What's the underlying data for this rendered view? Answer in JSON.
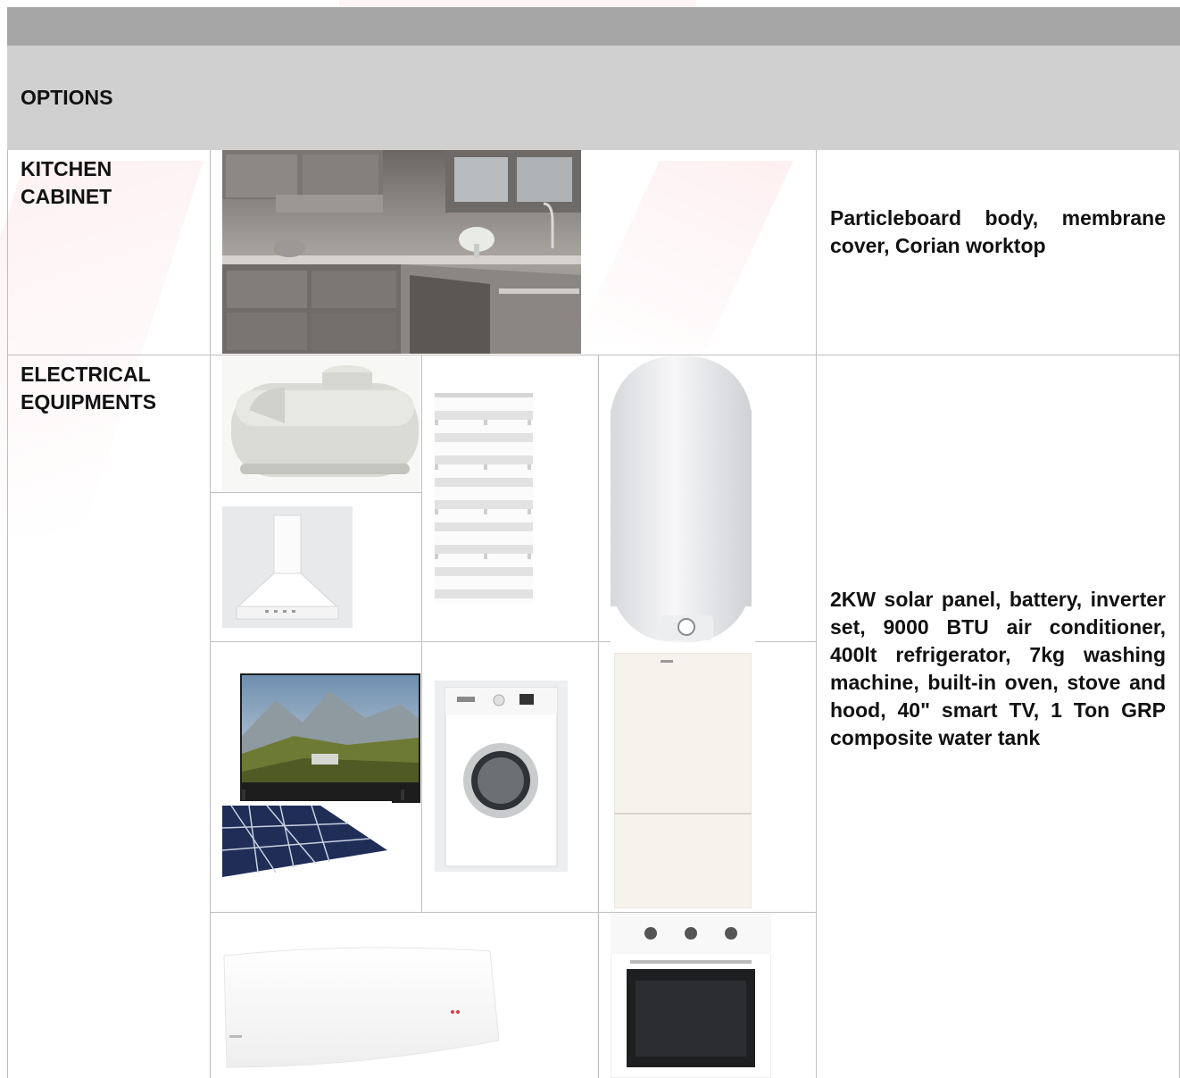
{
  "header": {
    "options_label": "OPTIONS"
  },
  "rows": [
    {
      "label_line1": "KITCHEN",
      "label_line2": "CABINET",
      "description": "Particleboard body, membrane cover, Corian worktop"
    },
    {
      "label_line1": "ELECTRICAL",
      "label_line2": "EQUIPMENTS",
      "description": "2KW solar panel, battery, inverter set, 9000 BTU air conditioner, 400lt refrigerator, 7kg washing machine, built-in oven, stove and hood, 40\" smart TV, 1 Ton GRP composite water tank"
    }
  ],
  "colors": {
    "header_dark": "#a6a6a6",
    "header_light": "#d0d0d0",
    "grid_line": "#bfbfbf",
    "watermark": "#e6505a"
  },
  "images": [
    "kitchen-cabinet-photo",
    "water-tank-photo",
    "zebra-blind-photo",
    "water-heater-photo",
    "cooker-hood-photo",
    "smart-tv-photo",
    "solar-panel-photo",
    "washing-machine-photo",
    "refrigerator-photo",
    "air-conditioner-photo",
    "built-in-oven-photo"
  ]
}
